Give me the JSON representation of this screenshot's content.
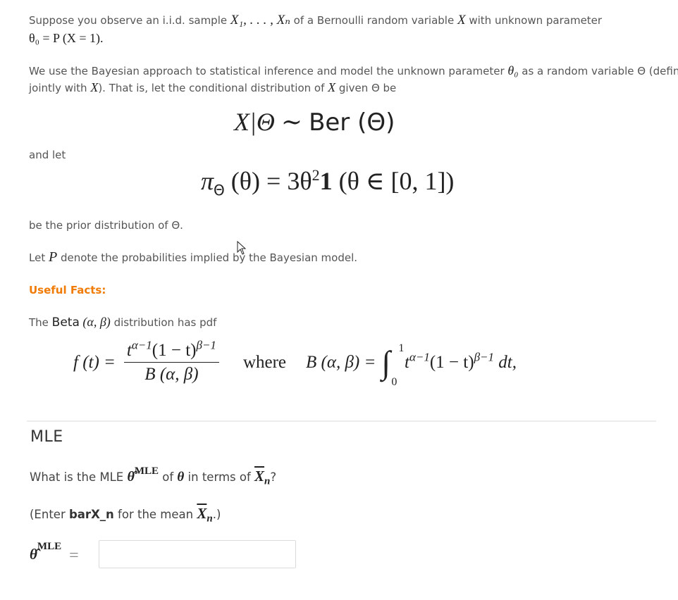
{
  "intro": {
    "p1_a": "Suppose you observe an i.i.d. sample ",
    "p1_sample": "X₁, . . . , Xₙ",
    "p1_b": " of a Bernoulli random variable ",
    "p1_X": "X",
    "p1_c": " with unknown parameter",
    "p1_line2": "θ₀ = P (X = 1).",
    "p2_a": "We use the Bayesian approach to statistical inference and model the unknown parameter ",
    "p2_theta0": "θ₀",
    "p2_b": " as a random variable Θ (defined",
    "p2_line2_a": "jointly with ",
    "p2_line2_X": "X",
    "p2_line2_b": "). That is, let the conditional distribution of ",
    "p2_line2_X2": "X",
    "p2_line2_c": " given Θ be"
  },
  "equations": {
    "likelihood_left": "X|Θ ∼ ",
    "likelihood_right": "Ber (Θ)",
    "and_let": "and let",
    "prior_pi": "π",
    "prior_sub": "Θ",
    "prior_rest": " (θ) = 3θ",
    "prior_exp": "2",
    "prior_one": "1",
    "prior_tail": " (θ ∈ [0, 1])",
    "prior_caption": "be the prior distribution of Θ."
  },
  "model_note": {
    "a": "Let ",
    "P": "P",
    "b": " denote the probabilities implied by the Bayesian model."
  },
  "useful_facts": {
    "heading": "Useful Facts:",
    "beta_a": "The ",
    "beta_name": "Beta",
    "beta_args": " (α, β)",
    "beta_b": " distribution has pdf",
    "pdf_lhs": "f (t) =",
    "pdf_num": "t^(α−1)(1 − t)^(β−1)",
    "pdf_num_t": "t",
    "pdf_num_e1": "α−1",
    "pdf_num_mid": "(1 − t)",
    "pdf_num_e2": "β−1",
    "pdf_den": "B (α, β)",
    "where": "where",
    "beta_fn_lhs": "B (α, β) =",
    "integral": "∫",
    "int_upper": "1",
    "int_lower": "0",
    "int_t": "t",
    "int_e1": "α−1",
    "int_mid": "(1 − t)",
    "int_e2": "β−1",
    "int_dt": " dt,"
  },
  "mle": {
    "heading": "MLE",
    "question_a": "What is the MLE ",
    "theta_hat": "θ̂",
    "mle_sup": "MLE",
    "question_b": " of ",
    "theta": "θ",
    "question_c": " in terms of ",
    "xbar": "X",
    "xbar_sub": "n",
    "question_d": "?",
    "hint_a": "(Enter ",
    "hint_bold": "barX_n",
    "hint_b": " for the mean ",
    "hint_c": ".)",
    "answer_label_theta": "θ̂",
    "answer_label_sup": "MLE",
    "answer_eq": "=",
    "answer_value": ""
  },
  "colors": {
    "accent_orange": "#f07b05",
    "body_text": "#555555",
    "divider": "#ececec"
  }
}
